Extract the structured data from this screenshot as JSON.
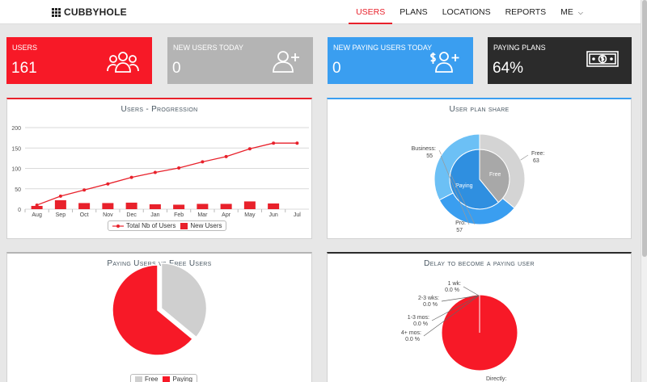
{
  "brand": {
    "name": "CUBBYHOLE",
    "icon": "grid-icon"
  },
  "nav": {
    "items": [
      "USERS",
      "PLANS",
      "LOCATIONS",
      "REPORTS",
      "ME"
    ],
    "active": "USERS"
  },
  "stats": [
    {
      "label": "USERS",
      "value": "161",
      "color": "#f71927",
      "icon": "users-group-icon"
    },
    {
      "label": "NEW USERS TODAY",
      "value": "0",
      "color": "#b4b4b4",
      "icon": "user-plus-icon"
    },
    {
      "label": "NEW PAYING USERS TODAY",
      "value": "0",
      "color": "#3a9ef0",
      "icon": "dollar-user-plus-icon"
    },
    {
      "label": "PAYING PLANS",
      "value": "64%",
      "color": "#2b2b2b",
      "icon": "banknote-icon"
    }
  ],
  "panels": {
    "progression": {
      "title": "Users - Progression",
      "accent": "#e8212b"
    },
    "plan_share": {
      "title": "User plan share",
      "accent": "#3a9ef0"
    },
    "paying_free": {
      "title": "Paying Users vs Free Users",
      "accent": "#b4b4b4"
    },
    "delay": {
      "title": "Delay to become a paying user",
      "accent": "#2b2b2b"
    }
  },
  "chart_data": [
    {
      "type": "line",
      "title": "Users - Progression",
      "categories": [
        "Aug",
        "Sep",
        "Oct",
        "Nov",
        "Dec",
        "Jan",
        "Feb",
        "Mar",
        "Apr",
        "May",
        "Jun",
        "Jul"
      ],
      "series": [
        {
          "name": "Total Nb of Users",
          "type": "line",
          "values": [
            10,
            32,
            47,
            62,
            78,
            90,
            101,
            116,
            129,
            148,
            162,
            162
          ]
        },
        {
          "name": "New Users",
          "type": "bar",
          "values": [
            8,
            22,
            15,
            15,
            16,
            12,
            11,
            13,
            13,
            19,
            14,
            0
          ]
        }
      ],
      "ylim": [
        0,
        200
      ],
      "yticks": [
        "0",
        "50",
        "100",
        "150",
        "200"
      ],
      "grid": true,
      "legend": "bottom",
      "colors": {
        "line": "#e8212b",
        "bar": "#e8212b"
      }
    },
    {
      "type": "pie",
      "title": "User plan share",
      "inner": [
        {
          "label": "Free",
          "value": 63,
          "color": "#a8a8a8"
        },
        {
          "label": "Paying",
          "value": 98,
          "color": "#2f8fe0"
        }
      ],
      "outer": [
        {
          "label": "Free:",
          "value": "63",
          "num": 63,
          "color": "#d4d4d4"
        },
        {
          "label": "Business:",
          "value": "55",
          "num": 55,
          "color": "#3a9ef0"
        },
        {
          "label": "Pro:",
          "value": "57",
          "num": 57,
          "color": "#6cc0f5"
        }
      ]
    },
    {
      "type": "pie",
      "title": "Paying Users vs Free Users",
      "slices": [
        {
          "label": "Free",
          "value": 36,
          "color": "#cfcfcf"
        },
        {
          "label": "Paying",
          "value": 64,
          "color": "#f71927"
        }
      ],
      "legend": "bottom"
    },
    {
      "type": "pie",
      "title": "Delay to become a paying user",
      "slices": [
        {
          "label": "1 wk:",
          "pct": "0.0 %",
          "value": 0
        },
        {
          "label": "2-3 wks:",
          "pct": "0.0 %",
          "value": 0
        },
        {
          "label": "1-3 mos:",
          "pct": "0.0 %",
          "value": 0
        },
        {
          "label": "4+ mos:",
          "pct": "0.0 %",
          "value": 0
        },
        {
          "label": "Directly:",
          "pct": "",
          "value": 100
        }
      ],
      "color": "#f71927"
    }
  ]
}
